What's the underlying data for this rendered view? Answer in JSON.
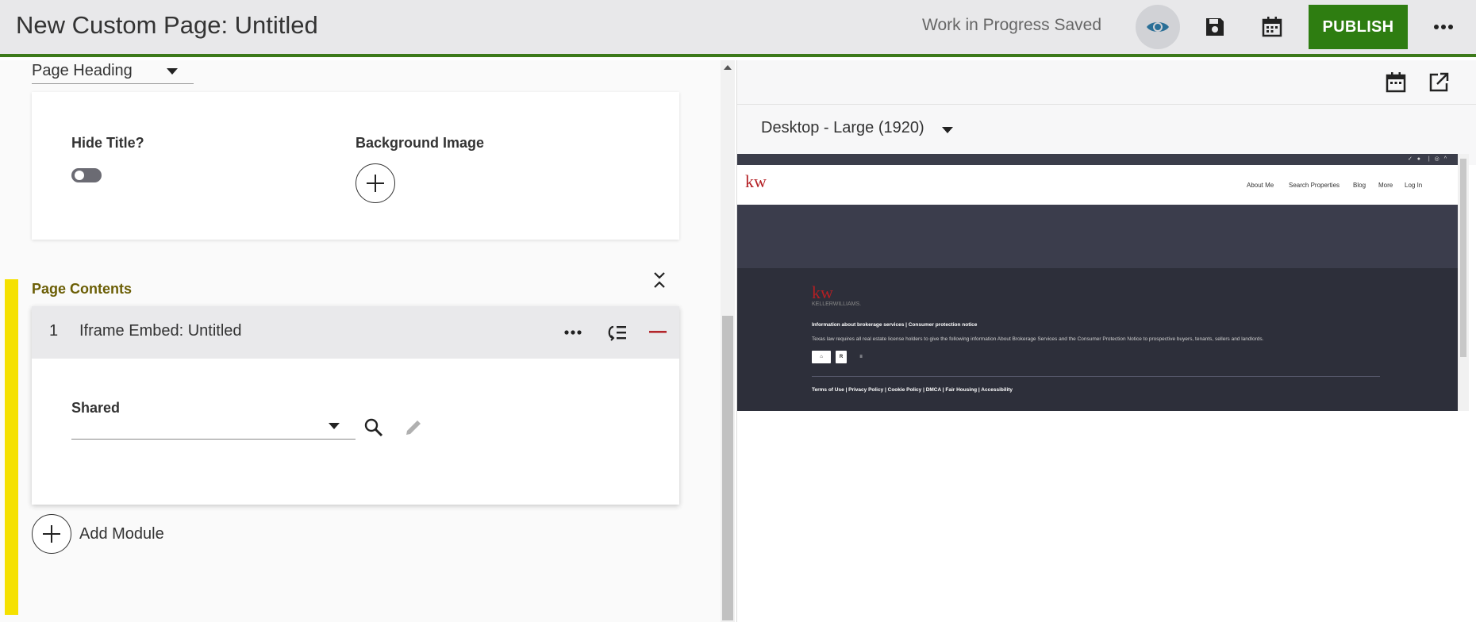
{
  "topbar": {
    "title": "New Custom Page: Untitled",
    "status": "Work in Progress Saved",
    "publish_label": "PUBLISH",
    "accent_color": "#2e7d11"
  },
  "left": {
    "page_heading_select": "Page Heading",
    "hide_title_label": "Hide Title?",
    "hide_title_value": false,
    "background_image_label": "Background Image",
    "page_contents_label": "Page Contents",
    "module": {
      "number": "1",
      "title": "Iframe Embed: Untitled",
      "shared_label": "Shared",
      "shared_value": ""
    },
    "add_module_label": "Add Module"
  },
  "right": {
    "device_select": "Desktop - Large (1920)",
    "preview": {
      "logo": "kw",
      "nav": [
        "About Me",
        "Search Properties",
        "Blog",
        "More",
        "Log In"
      ],
      "footer_logo": "kw",
      "footer_logo_sub": "KELLERWILLIAMS.",
      "info_links": "Information about brokerage services  |  Consumer protection notice",
      "info_text": "Texas law requires all real estate license holders to give the following information About Brokerage Services and the Consumer Protection Notice to prospective buyers, tenants, sellers and landlords.",
      "footer_links": "Terms of Use | Privacy Policy | Cookie Policy | DMCA | Fair Housing | Accessibility"
    }
  }
}
